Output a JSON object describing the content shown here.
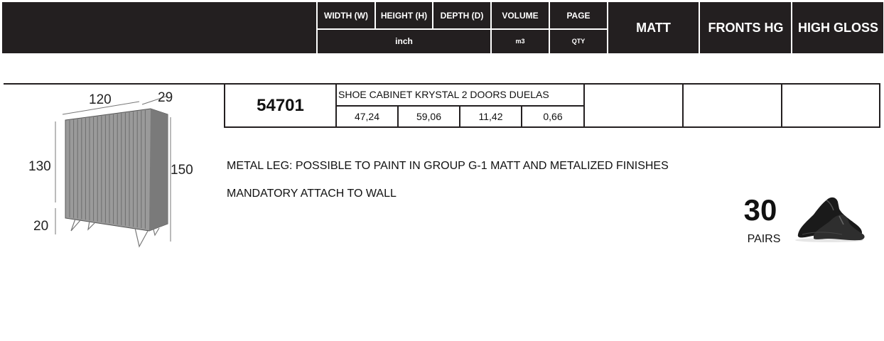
{
  "header": {
    "width_label": "WIDTH (W)",
    "height_label": "HEIGHT (H)",
    "depth_label": "DEPTH (D)",
    "volume_label": "VOLUME",
    "page_label": "PAGE",
    "unit_label": "inch",
    "volume_unit": "m3",
    "page_unit": "QTY",
    "finish_matt": "MATT",
    "finish_fronts_hg": "FRONTS HG",
    "finish_high_gloss": "HIGH GLOSS"
  },
  "product": {
    "code": "54701",
    "name": "SHOE CABINET KRYSTAL 2 DOORS DUELAS",
    "width": "47,24",
    "height": "59,06",
    "depth": "11,42",
    "volume": "0,66"
  },
  "notes": [
    "METAL LEG: POSSIBLE TO PAINT IN GROUP G-1 MATT AND METALIZED FINISHES",
    "MANDATORY ATTACH TO WALL"
  ],
  "capacity": {
    "value": "30",
    "unit": "PAIRS",
    "icon": "shoes-icon"
  },
  "drawing": {
    "dim_width": "120",
    "dim_depth": "29",
    "dim_body_height": "130",
    "dim_total_height": "150",
    "dim_leg_height": "20"
  },
  "colors": {
    "header_bg": "#231f20",
    "cabinet": "#8f8f8f"
  }
}
